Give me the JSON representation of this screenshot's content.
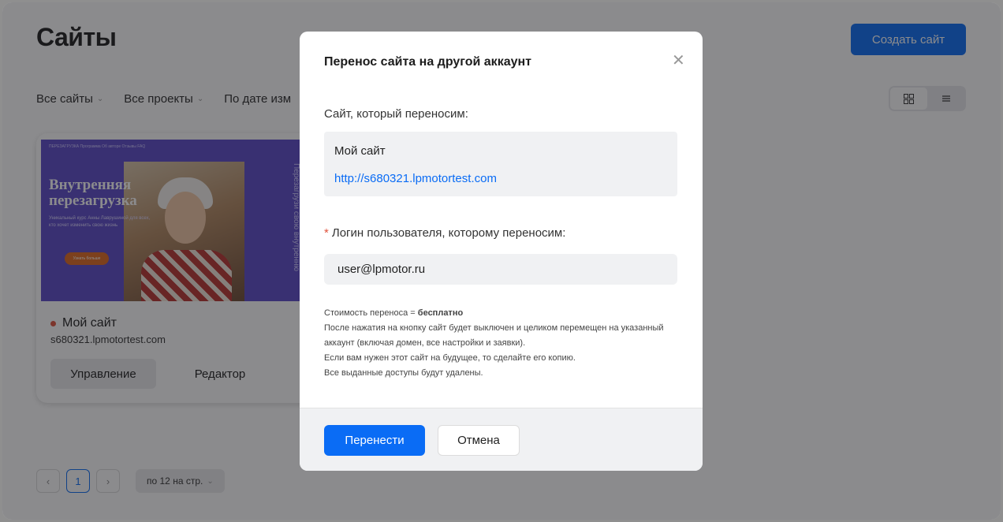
{
  "header": {
    "title": "Сайты",
    "create_button": "Создать сайт"
  },
  "filters": {
    "all_sites": "Все сайты",
    "all_projects": "Все проекты",
    "sort": "По дате изм"
  },
  "view_toggle": {
    "grid_icon": "grid-icon",
    "list_icon": "list-icon"
  },
  "site_card": {
    "name": "Мой сайт",
    "status_color": "#e0533d",
    "url": "s680321.lpmotortest.com",
    "manage_button": "Управление",
    "editor_button": "Редактор",
    "thumbnail": {
      "nav_text": "ПЕРЕЗАГРУЗКА      Программа   Об авторе   Отзывы   FAQ",
      "headline_1": "Внутренняя",
      "headline_2": "перезагрузка",
      "subtext": "Уникальный курс Анны Лаврушиной для всех, кто хочет изменить свою жизнь",
      "cta": "Узнать больше",
      "vertical_text": "Перезагрузи свою внутренню"
    }
  },
  "pagination": {
    "current_page": "1",
    "per_page": "по 12 на стр."
  },
  "modal": {
    "title": "Перенос сайта на другой аккаунт",
    "site_label": "Сайт, который переносим:",
    "site_name": "Мой сайт",
    "site_url": "http://s680321.lpmotortest.com",
    "login_label": "Логин пользователя, которому переносим:",
    "required_mark": "*",
    "login_value": "user@lpmotor.ru",
    "cost_label": "Стоимость переноса = ",
    "cost_value": "бесплатно",
    "info_1": "После нажатия на кнопку сайт будет выключен и целиком перемещен на указанный аккаунт (включая домен, все настройки и заявки).",
    "info_2": "Если вам нужен этот сайт на будущее, то сделайте его копию.",
    "info_3": "Все выданные доступы будут удалены.",
    "transfer_button": "Перенести",
    "cancel_button": "Отмена"
  },
  "colors": {
    "accent": "#0a6cf5",
    "overlay": "rgba(24,24,28,0.5)"
  }
}
